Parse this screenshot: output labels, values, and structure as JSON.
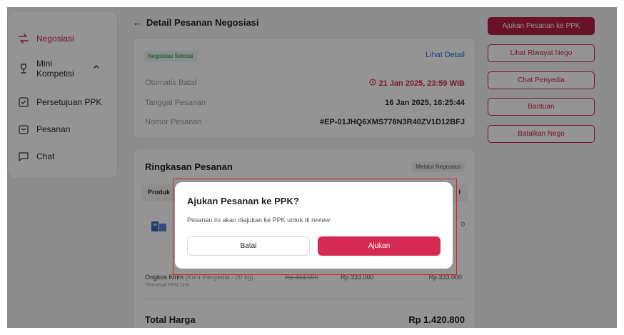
{
  "sidebar": {
    "items": [
      {
        "label": "Negosiasi",
        "icon": "swap-icon",
        "active": true
      },
      {
        "label": "Mini Kompetisi",
        "icon": "trophy-icon",
        "active": false
      },
      {
        "label": "Persetujuan PPK",
        "icon": "approve-icon",
        "active": false
      },
      {
        "label": "Pesanan",
        "icon": "box-icon",
        "active": false
      },
      {
        "label": "Chat",
        "icon": "chat-icon",
        "active": false
      }
    ]
  },
  "header": {
    "back_symbol": "←",
    "title": "Detail Pesanan Negosiasi"
  },
  "info_card": {
    "status_badge": "Negosiasi Selesai",
    "detail_link": "Lihat Detail",
    "rows": [
      {
        "label": "Otomatis Batal",
        "value": "21 Jan 2025, 23:59 WIB"
      },
      {
        "label": "Tanggal Pesanan",
        "value": "16 Jan 2025, 16:25:44"
      },
      {
        "label": "Nomor Pesanan",
        "value": "#EP-01JHQ6XMS778N3R40ZV1D12BFJ"
      }
    ]
  },
  "summary": {
    "title": "Ringkasan Pesanan",
    "badge": "Melalui Negosiasi",
    "col_product": "Produk",
    "col_total_tail": "l",
    "partial_price_tail": "0",
    "shipping_label": "Ongkos Kirim",
    "shipping_sub": "(Kurir Penyedia - 20 kg)",
    "shipping_note": "Termasuk PPN 11%",
    "price_original": "Rp 444.000",
    "price_nego": "Rp 333.000",
    "price_total": "Rp 333.000",
    "total_label": "Total Harga",
    "total_value": "Rp 1.420.800"
  },
  "actions": {
    "submit_ppk": "Ajukan Pesanan ke PPK",
    "history": "Lihat Riwayat Nego",
    "chat_vendor": "Chat Penyedia",
    "help": "Bantuan",
    "cancel_nego": "Batalkan Nego"
  },
  "modal": {
    "title": "Ajukan Pesanan ke PPK?",
    "text": "Pesanan ini akan diajukan ke PPK untuk di review.",
    "cancel": "Batal",
    "confirm": "Ajukan"
  },
  "colors": {
    "accent": "#c8264a",
    "primary_button": "#b51f44",
    "confirm_button": "#d52a52",
    "link": "#3c6bd8",
    "success": "#1f8a3a"
  }
}
